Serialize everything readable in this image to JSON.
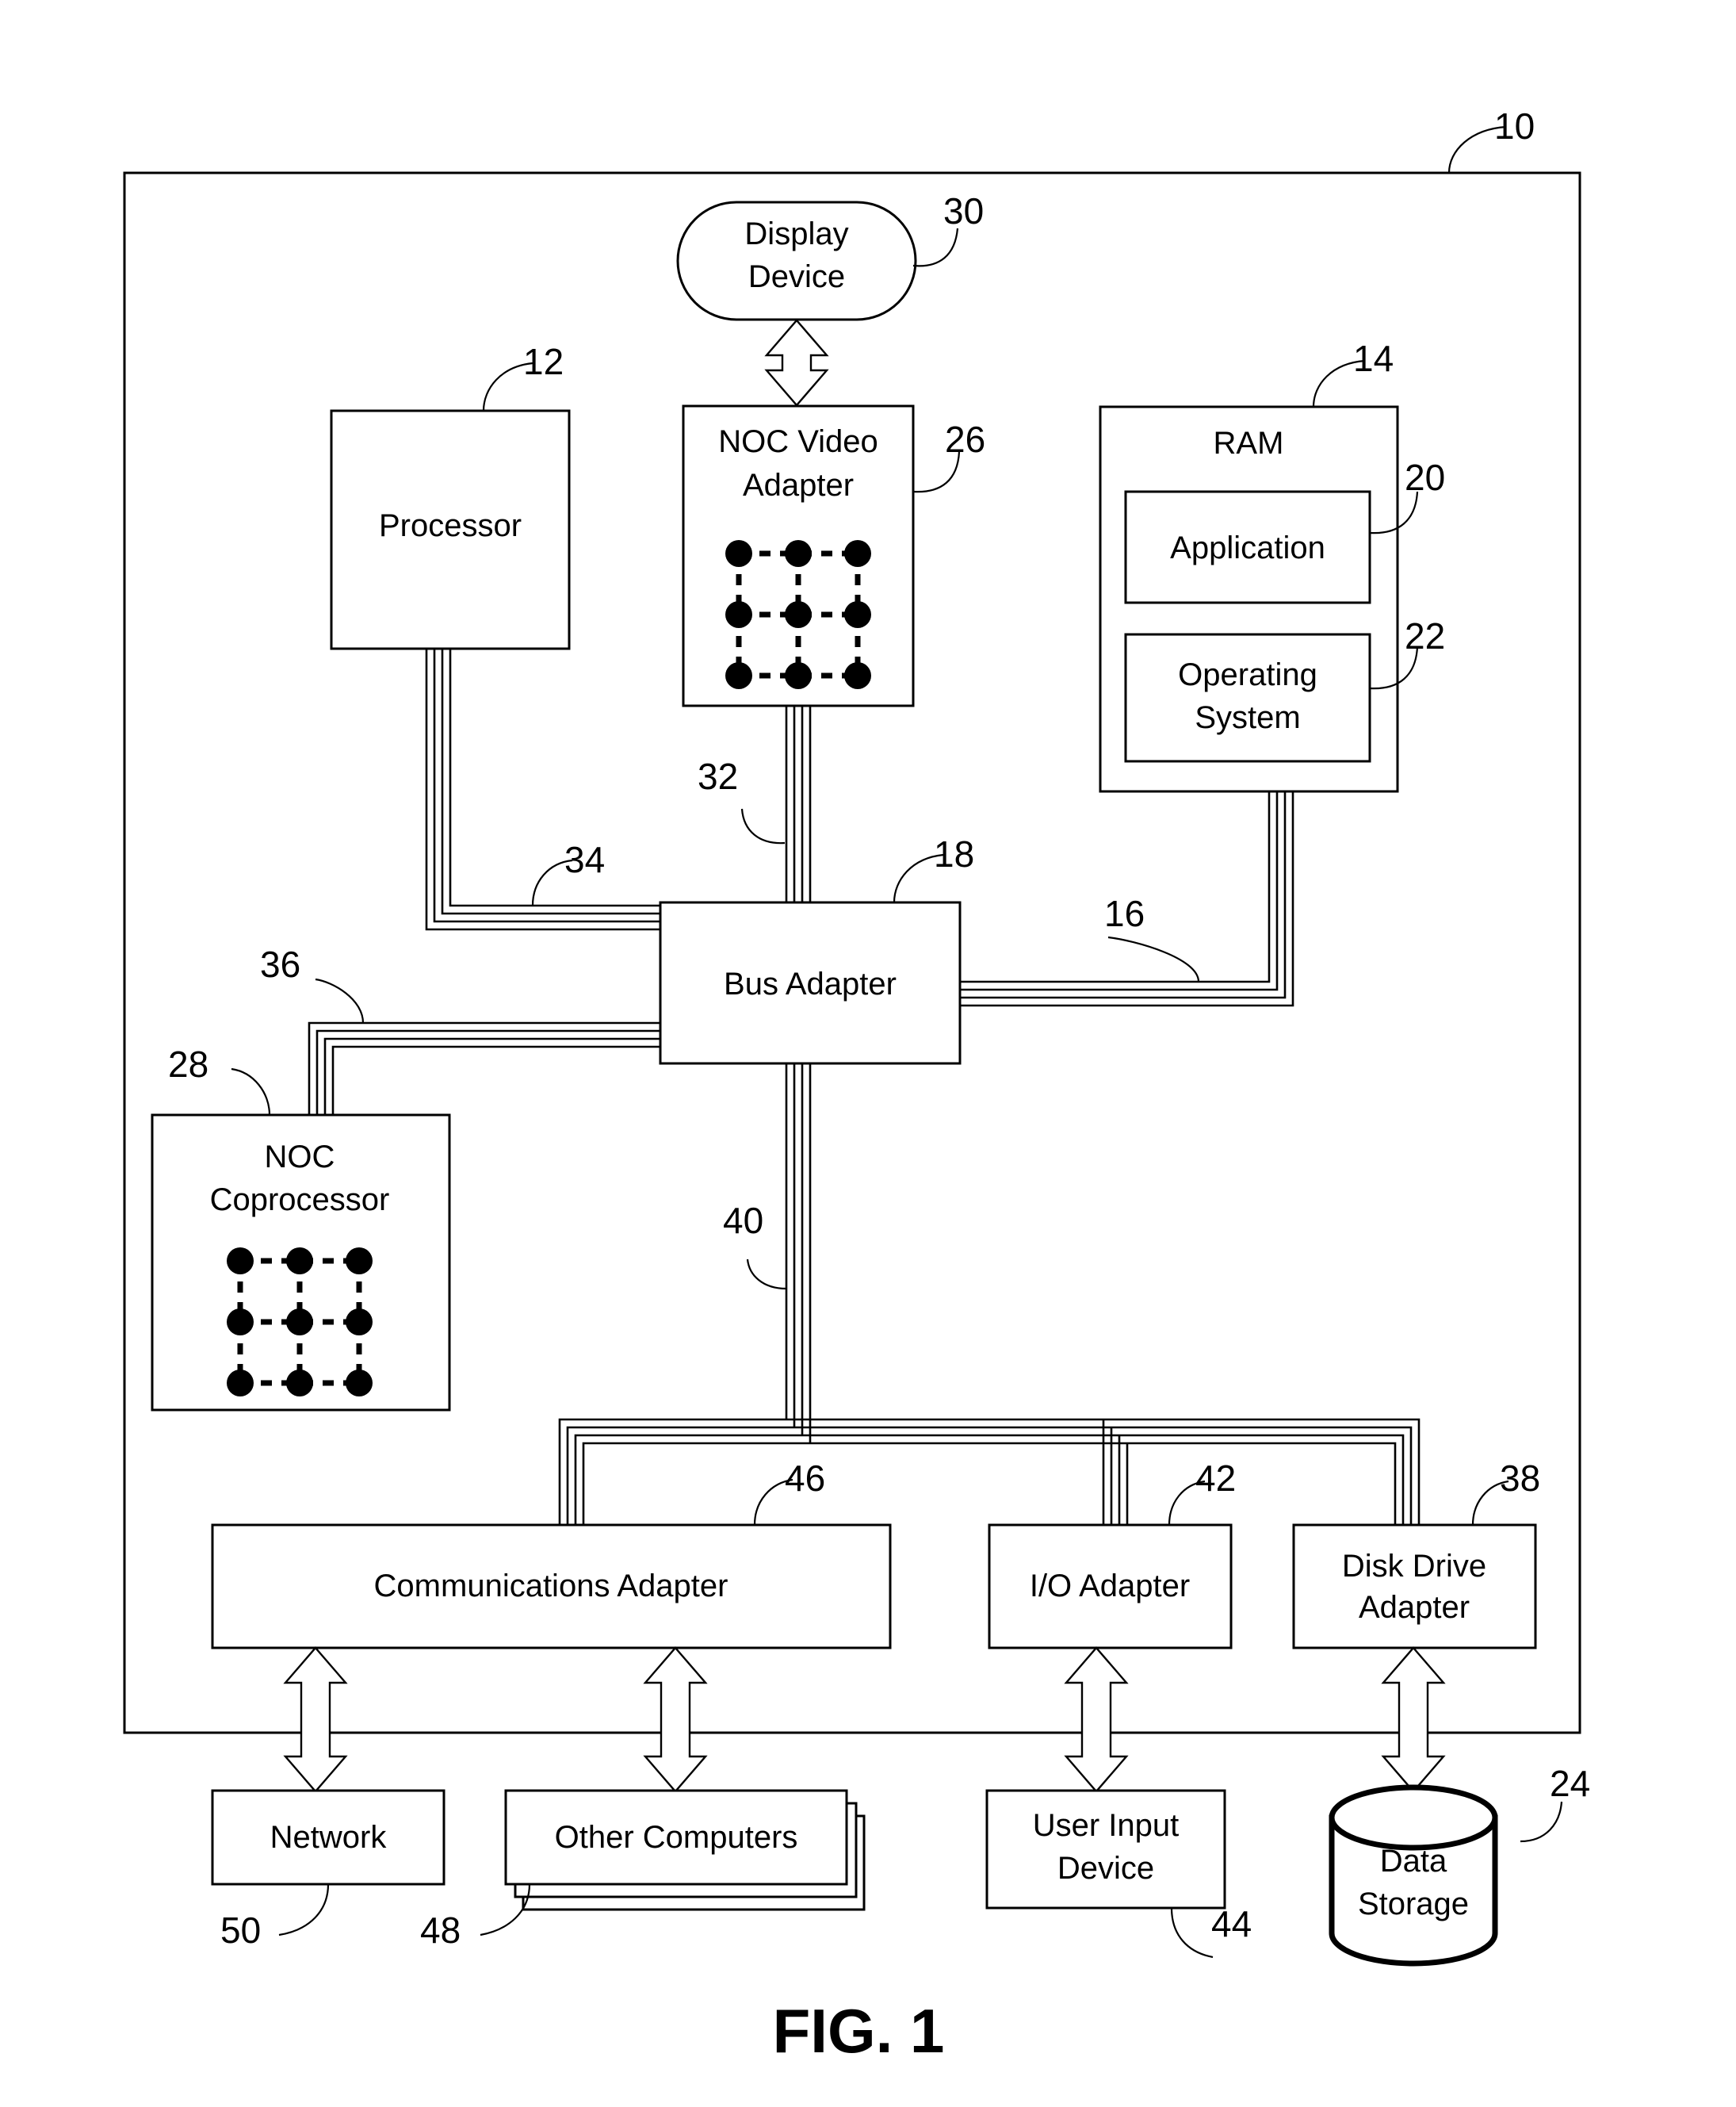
{
  "figure": {
    "caption": "FIG. 1",
    "system_ref": "10"
  },
  "blocks": {
    "display_device": {
      "label_line1": "Display",
      "label_line2": "Device",
      "ref": "30"
    },
    "processor": {
      "label": "Processor",
      "ref": "12"
    },
    "noc_video_adapter": {
      "label_line1": "NOC Video",
      "label_line2": "Adapter",
      "ref": "26"
    },
    "ram": {
      "label": "RAM",
      "ref": "14"
    },
    "application": {
      "label": "Application",
      "ref": "20"
    },
    "operating_system": {
      "label_line1": "Operating",
      "label_line2": "System",
      "ref": "22"
    },
    "bus_adapter": {
      "label": "Bus Adapter",
      "ref": "18"
    },
    "noc_coprocessor": {
      "label_line1": "NOC",
      "label_line2": "Coprocessor",
      "ref": "28"
    },
    "communications_adapter": {
      "label": "Communications Adapter",
      "ref": "46"
    },
    "io_adapter": {
      "label": "I/O Adapter",
      "ref": "42"
    },
    "disk_drive_adapter": {
      "label_line1": "Disk Drive",
      "label_line2": "Adapter",
      "ref": "38"
    },
    "network": {
      "label": "Network",
      "ref": "50"
    },
    "other_computers": {
      "label": "Other Computers",
      "ref": "48"
    },
    "user_input_device": {
      "label_line1": "User Input",
      "label_line2": "Device",
      "ref": "44"
    },
    "data_storage": {
      "label_line1": "Data",
      "label_line2": "Storage",
      "ref": "24"
    }
  },
  "buses": {
    "front_side_bus_processor": {
      "ref": "34"
    },
    "front_side_bus_video": {
      "ref": "32"
    },
    "memory_bus": {
      "ref": "16"
    },
    "coprocessor_bus": {
      "ref": "36"
    },
    "expansion_bus": {
      "ref": "40"
    }
  }
}
